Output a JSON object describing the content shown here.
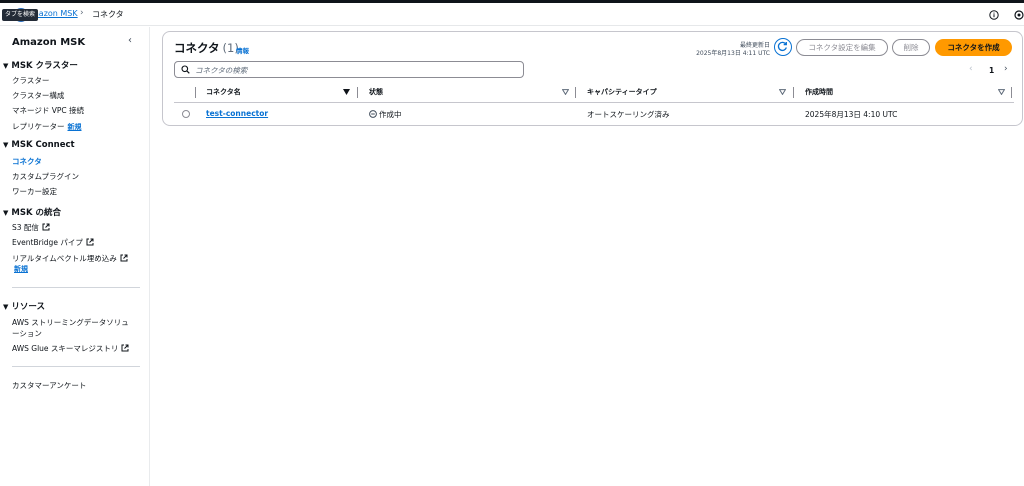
{
  "header": {
    "tooltip": "タブを検索",
    "breadcrumb_link": "mazon MSK",
    "breadcrumb_current": "コネクタ"
  },
  "sidebar": {
    "title": "Amazon MSK",
    "sections": {
      "cluster": {
        "label": "MSK クラスター",
        "items": [
          "クラスター",
          "クラスター構成",
          "マネージド VPC 接続",
          "レプリケーター"
        ],
        "new_badge": "新規"
      },
      "connect": {
        "label": "MSK Connect",
        "items": [
          "コネクタ",
          "カスタムプラグイン",
          "ワーカー設定"
        ]
      },
      "integration": {
        "label": "MSK の統合",
        "items": [
          "S3 配信",
          "EventBridge パイプ",
          "リアルタイムベクトル埋め込み"
        ],
        "new_badge": "新規"
      },
      "resources": {
        "label": "リソース",
        "items": [
          "AWS ストリーミングデータソリュ",
          "ーション",
          "AWS Glue スキーマレジストリ"
        ]
      }
    },
    "survey": "カスタマーアンケート"
  },
  "main": {
    "title": "コネクタ",
    "count": "(1)",
    "info_link": "情報",
    "updated_label": "最終更新日",
    "updated_time": "2025年8月13日 4:11 UTC",
    "edit_button": "コネクタ設定を編集",
    "delete_button": "削除",
    "create_button": "コネクタを作成",
    "search_placeholder": "コネクタの検索",
    "page_number": "1",
    "columns": [
      "コネクタ名",
      "状態",
      "キャパシティータイプ",
      "作成時間"
    ],
    "row": {
      "name": "test-connector",
      "status": "作成中",
      "capacity": "オートスケーリング済み",
      "created": "2025年8月13日 4:10 UTC"
    }
  },
  "colors": {
    "accent": "#0972d3",
    "primary_button": "#ff9900",
    "border": "#c6c6cd"
  }
}
